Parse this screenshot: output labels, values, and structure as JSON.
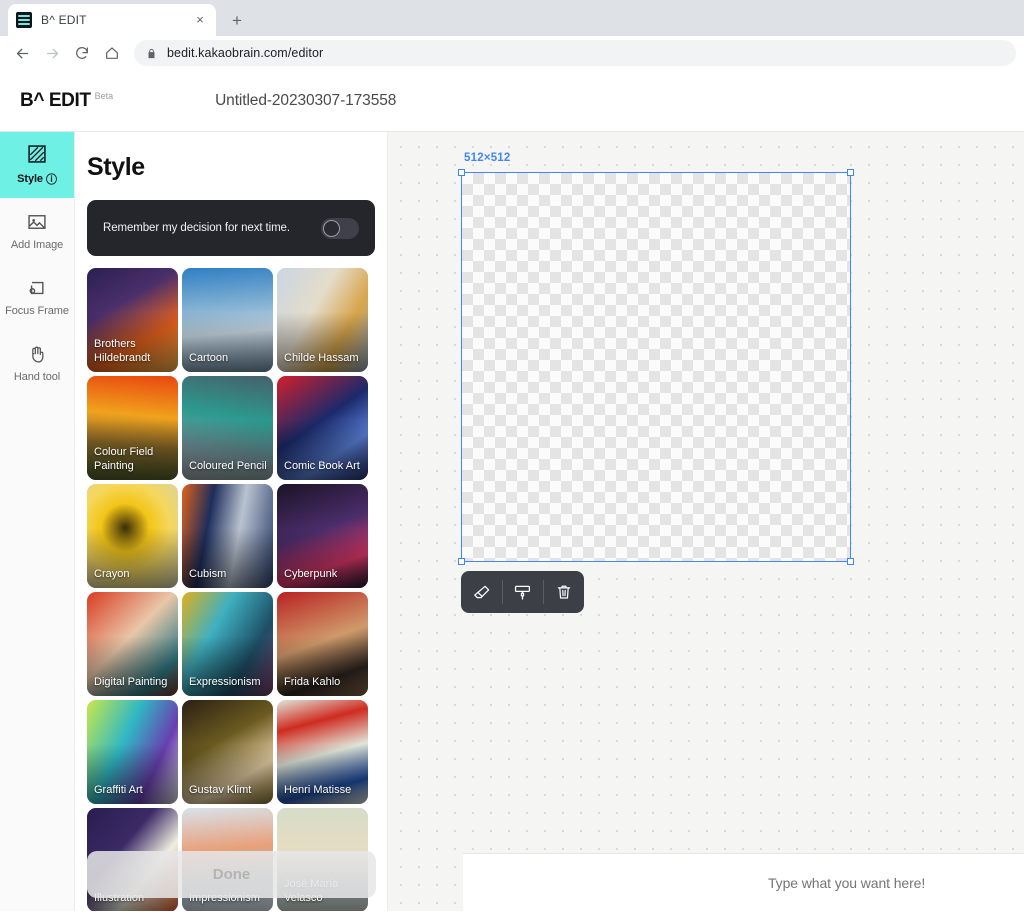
{
  "browser": {
    "tab": {
      "title": "B^ EDIT",
      "favicon": "bedit-favicon",
      "close_label": "×"
    },
    "new_tab_label": "+",
    "nav": {
      "back": "back-arrow",
      "forward": "forward-arrow",
      "reload": "reload",
      "home": "home"
    },
    "omnibox": {
      "url": "bedit.kakaobrain.com/editor",
      "lock": "lock-icon"
    }
  },
  "app": {
    "brand": "B^ EDIT",
    "brand_badge": "Beta",
    "document_title": "Untitled-20230307-173558"
  },
  "tools": [
    {
      "id": "style",
      "label": "Style",
      "icon": "style-hatch-icon",
      "info": "ⓘ",
      "active": true
    },
    {
      "id": "add-image",
      "label": "Add Image",
      "icon": "image-icon",
      "active": false
    },
    {
      "id": "focus-frame",
      "label": "Focus Frame",
      "icon": "focus-frame-icon",
      "active": false
    },
    {
      "id": "hand-tool",
      "label": "Hand tool",
      "icon": "hand-icon",
      "active": false
    }
  ],
  "style_panel": {
    "title": "Style",
    "remember_label": "Remember my decision for next time.",
    "remember_toggle_on": false,
    "done_label": "Done",
    "styles": [
      {
        "name": "Brothers Hildebrandt",
        "c1": "#2a2050",
        "c2": "#e8631c",
        "c3": "#f4b14a"
      },
      {
        "name": "Cartoon",
        "c1": "#2f7fc4",
        "c2": "#cfe0ec",
        "c3": "#6f8fa6"
      },
      {
        "name": "Childe Hassam",
        "c1": "#c9d6e3",
        "c2": "#d8a54a",
        "c3": "#8fa6bb"
      },
      {
        "name": "Colour Field Painting",
        "c1": "#e8470f",
        "c2": "#f0a21d",
        "c3": "#4a5c2a"
      },
      {
        "name": "Coloured Pencil",
        "c1": "#2c9a8f",
        "c2": "#7d9aa3",
        "c3": "#46606b"
      },
      {
        "name": "Comic Book Art",
        "c1": "#1b2a6b",
        "c2": "#d21f2b",
        "c3": "#5a7fd6"
      },
      {
        "name": "Crayon",
        "c1": "#f2c517",
        "c2": "#cfd2b4",
        "c3": "#6f8a33"
      },
      {
        "name": "Cubism",
        "c1": "#1d2d5c",
        "c2": "#e0621b",
        "c3": "#b9c3cf"
      },
      {
        "name": "Cyberpunk",
        "c1": "#1a1326",
        "c2": "#e0386a",
        "c3": "#4b2d6b"
      },
      {
        "name": "Digital Painting",
        "c1": "#d93c22",
        "c2": "#e8c7a8",
        "c3": "#2f7a86"
      },
      {
        "name": "Expressionism",
        "c1": "#1d4f66",
        "c2": "#e0b01c",
        "c3": "#3fb0c0"
      },
      {
        "name": "Frida Kahlo",
        "c1": "#b92222",
        "c2": "#2f2620",
        "c3": "#cf9a6a"
      },
      {
        "name": "Graffiti Art",
        "c1": "#c9e84a",
        "c2": "#2fb8c4",
        "c3": "#6a3fb0"
      },
      {
        "name": "Gustav Klimt",
        "c1": "#6b5a20",
        "c2": "#e8d2a8",
        "c3": "#2a2014"
      },
      {
        "name": "Henri Matisse",
        "c1": "#e0e6d8",
        "c2": "#cf2b20",
        "c3": "#1f4fa8"
      },
      {
        "name": "Illustration",
        "c1": "#2a1d4f",
        "c2": "#f0eee0",
        "c3": "#e0622b"
      },
      {
        "name": "Impressionism",
        "c1": "#d8e2ea",
        "c2": "#e8a07a",
        "c3": "#9ab4c4"
      },
      {
        "name": "José María Velasco",
        "c1": "#d6ddc8",
        "c2": "#e8dcc0",
        "c3": "#a8bcc4"
      }
    ]
  },
  "canvas": {
    "size_label": "512×512",
    "selection_color": "#4285f4",
    "toolbar": [
      {
        "id": "eraser",
        "icon": "eraser-icon"
      },
      {
        "id": "fill",
        "icon": "paint-roller-icon"
      },
      {
        "id": "delete",
        "icon": "trash-icon"
      }
    ]
  },
  "prompt": {
    "value": "",
    "placeholder": "Type what you want here!"
  }
}
